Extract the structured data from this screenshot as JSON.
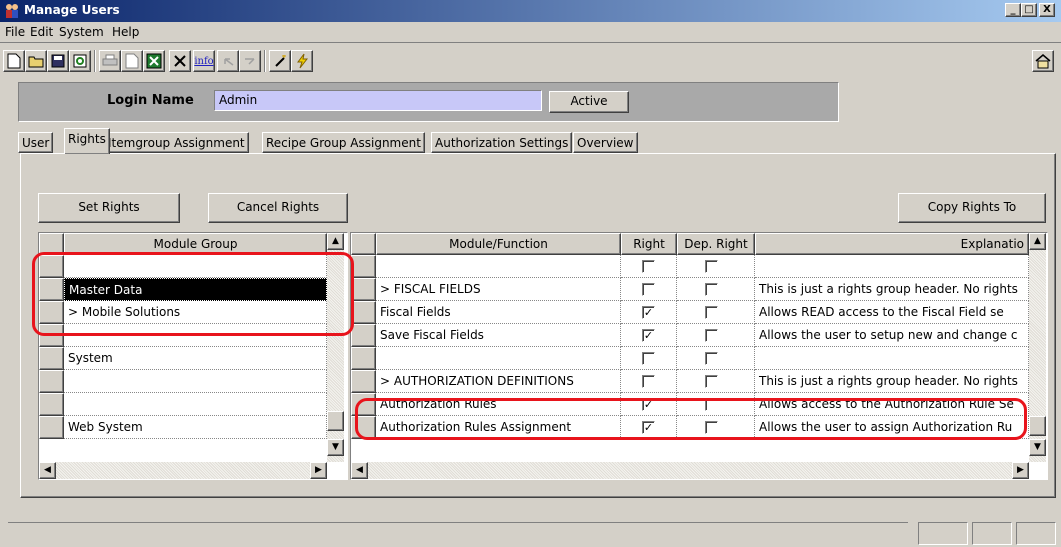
{
  "window": {
    "title": "Manage Users",
    "controls": {
      "minimize": "_",
      "maximize": "□",
      "close": "X"
    }
  },
  "menu": [
    "File",
    "Edit",
    "System",
    "Help"
  ],
  "toolbar": {
    "icons": [
      "new-icon",
      "open-icon",
      "save-icon",
      "refresh-icon",
      "print-icon",
      "print-preview-icon",
      "excel-icon",
      "delete-icon",
      "info-icon",
      "undo-icon",
      "redo-icon",
      "wand-icon",
      "lightning-icon",
      "home-icon"
    ],
    "info_label": "info"
  },
  "login": {
    "label": "Login Name",
    "value": "Admin",
    "active_button": "Active"
  },
  "tabs": [
    "User",
    "Rights",
    "Itemgroup Assignment",
    "Recipe Group Assignment",
    "Authorization Settings",
    "Overview"
  ],
  "active_tab": "Rights",
  "buttons": {
    "set_rights": "Set Rights",
    "cancel_rights": "Cancel Rights",
    "copy_rights_to": "Copy Rights To"
  },
  "module_grid": {
    "header": "Module Group",
    "rows": [
      "",
      "Master Data",
      "> Mobile Solutions",
      "",
      "System",
      "",
      "",
      "Web System"
    ],
    "selected_row": 1
  },
  "function_grid": {
    "headers": {
      "function": "Module/Function",
      "right": "Right",
      "dep_right": "Dep. Right",
      "explanation": "Explanatio"
    },
    "rows": [
      {
        "function": "",
        "right": false,
        "dep": false,
        "explanation": ""
      },
      {
        "function": "> FISCAL FIELDS",
        "right": false,
        "dep": false,
        "explanation": "This is just a rights group header. No rights"
      },
      {
        "function": "Fiscal Fields",
        "right": true,
        "dep": false,
        "explanation": "Allows READ access to the Fiscal Field se"
      },
      {
        "function": "Save Fiscal Fields",
        "right": true,
        "dep": false,
        "explanation": "Allows the user to setup new and change c"
      },
      {
        "function": "",
        "right": false,
        "dep": false,
        "explanation": ""
      },
      {
        "function": "> AUTHORIZATION DEFINITIONS",
        "right": false,
        "dep": false,
        "explanation": "This is just a rights group header. No rights"
      },
      {
        "function": "Authorization Rules",
        "right": true,
        "dep": false,
        "explanation": "Allows access to the Authorization Rule Se"
      },
      {
        "function": "Authorization Rules Assignment",
        "right": true,
        "dep": false,
        "explanation": "Allows the user to assign Authorization Ru"
      }
    ]
  },
  "colors": {
    "title_start": "#0a246a",
    "title_end": "#a6caf0",
    "highlight": "#e8141c",
    "selection": "#000000",
    "login_panel": "#a9a9a9",
    "login_input": "#c8c8f8"
  }
}
